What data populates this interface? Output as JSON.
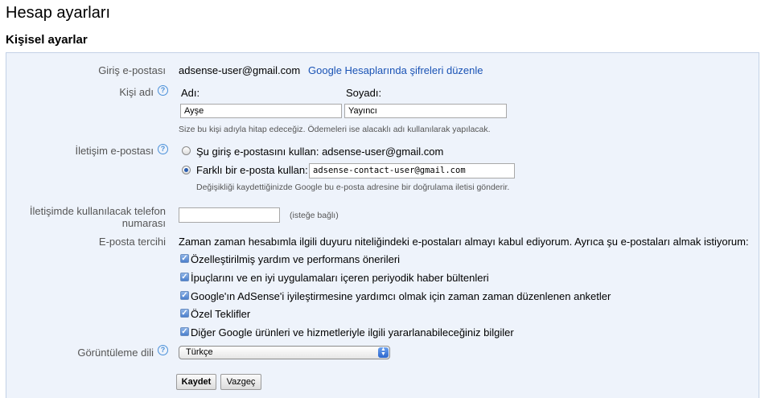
{
  "page": {
    "title": "Hesap ayarları",
    "section_title": "Kişisel ayarlar"
  },
  "login_email": {
    "label": "Giriş e-postası",
    "value": "adsense-user@gmail.com",
    "link": "Google Hesaplarında şifreleri düzenle"
  },
  "person_name": {
    "label": "Kişi adı",
    "first_label": "Adı:",
    "last_label": "Soyadı:",
    "first_value": "Ayşe",
    "last_value": "Yayıncı",
    "help": "Size bu kişi adıyla hitap edeceğiz. Ödemeleri ise alacaklı adı kullanılarak yapılacak."
  },
  "contact_email": {
    "label": "İletişim e-postası",
    "option1": "Şu giriş e-postasını kullan: adsense-user@gmail.com",
    "option2": "Farklı bir e-posta kullan:",
    "option2_value": "adsense-contact-user@gmail.com",
    "selected": "option2",
    "note": "Değişikliği kaydettiğinizde Google bu e-posta adresine bir doğrulama iletisi gönderir."
  },
  "phone": {
    "label_line1": "İletişimde kullanılacak telefon",
    "label_line2": "numarası",
    "value": "",
    "optional": "(isteğe bağlı)"
  },
  "email_pref": {
    "label": "E-posta tercihi",
    "intro": "Zaman zaman hesabımla ilgili duyuru niteliğindeki e-postaları almayı kabul ediyorum. Ayrıca şu e-postaları almak istiyorum:",
    "options": [
      {
        "label": "Özelleştirilmiş yardım ve performans önerileri",
        "checked": true
      },
      {
        "label": "İpuçlarını ve en iyi uygulamaları içeren periyodik haber bültenleri",
        "checked": true
      },
      {
        "label": "Google'ın AdSense'i iyileştirmesine yardımcı olmak için zaman zaman düzenlenen anketler",
        "checked": true
      },
      {
        "label": "Özel Teklifler",
        "checked": true
      },
      {
        "label": "Diğer Google ürünleri ve hizmetleriyle ilgili yararlanabileceğiniz bilgiler",
        "checked": true
      }
    ]
  },
  "display_lang": {
    "label": "Görüntüleme dili",
    "value": "Türkçe"
  },
  "buttons": {
    "save": "Kaydet",
    "cancel": "Vazgeç"
  },
  "icons": {
    "help": "help-icon",
    "check": "check-icon",
    "select_arrows": "updown-arrows-icon"
  },
  "colors": {
    "link": "#1a53b5",
    "panel_bg": "#eef3fb",
    "accent": "#4a90d9"
  }
}
